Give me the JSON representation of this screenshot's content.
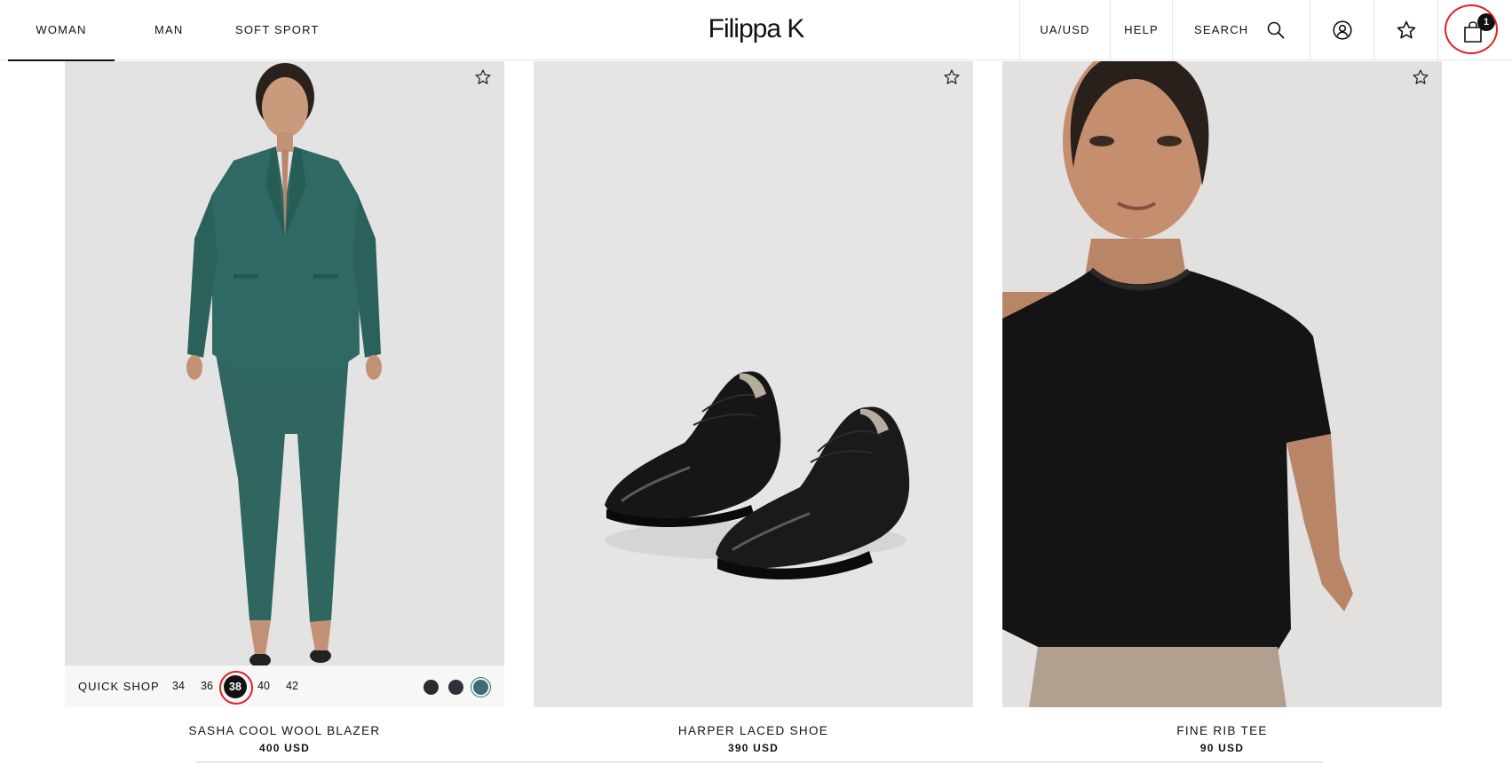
{
  "nav": {
    "woman": "WOMAN",
    "man": "MAN",
    "soft_sport": "SOFT SPORT"
  },
  "brand": {
    "logo": "Filippa K"
  },
  "utility": {
    "currency": "UA/USD",
    "help": "HELP",
    "search": "SEARCH",
    "bag_count": "1",
    "icons": [
      "search-icon",
      "account-icon",
      "wishlist-star-icon",
      "shopping-bag-icon"
    ]
  },
  "products": [
    {
      "name": "SASHA COOL WOOL BLAZER",
      "price": "400 USD",
      "quick_shop": {
        "label": "QUICK SHOP",
        "sizes": [
          "34",
          "36",
          "38",
          "40",
          "42"
        ],
        "selected_size": "38",
        "swatches": [
          "#2b2b2b",
          "#2e3138",
          "#3c6e72"
        ],
        "selected_swatch": 2
      }
    },
    {
      "name": "HARPER LACED SHOE",
      "price": "390 USD"
    },
    {
      "name": "FINE RIB TEE",
      "price": "90 USD"
    }
  ],
  "colors": {
    "text": "#111111",
    "accent_annotation": "#e02020",
    "image_background": "#e4e3e3"
  }
}
